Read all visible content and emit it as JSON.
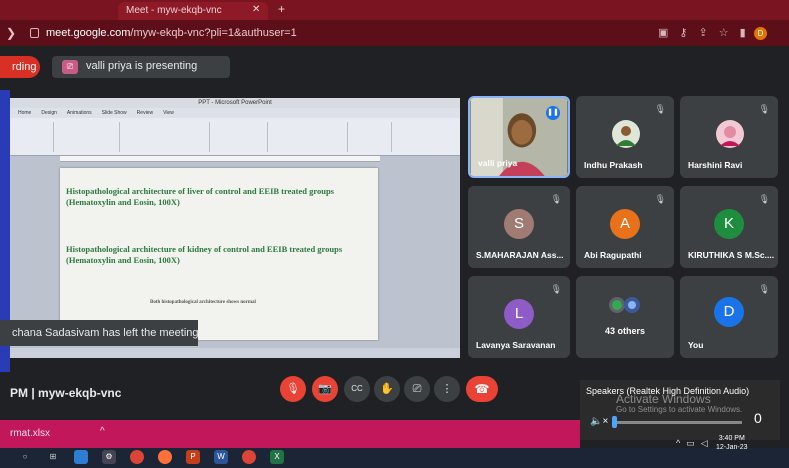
{
  "browser": {
    "tab_title": "Meet - myw-ekqb-vnc",
    "tab_close": "✕",
    "new_tab": "+",
    "url_host": "meet.google.com",
    "url_path": "/myw-ekqb-vnc?pli=1&authuser=1",
    "profile_initial": "D"
  },
  "meet": {
    "recording_label": "rding",
    "presenting_text": "valli priya is presenting",
    "toast": "chana Sadasivam has left the meeting",
    "meeting_info": "PM  |  myw-ekqb-vnc"
  },
  "presentation": {
    "window_title": "PPT - Microsoft PowerPoint",
    "ribbon_tabs": [
      "Home",
      "Design",
      "Animations",
      "Slide Show",
      "Review",
      "View"
    ],
    "slide_line_1": "Histopathological architecture of liver of control and EEIB treated groups (Hematoxylin and Eosin, 100X)",
    "slide_line_2": "Histopathological architecture of kidney of control and EEIB treated groups (Hematoxylin and Eosin, 100X)",
    "slide_note": "Both histopathological architecture shows normal"
  },
  "participants": [
    {
      "name": "valli priya",
      "type": "video",
      "speaking": true,
      "color": "#7a5a3a"
    },
    {
      "name": "Indhu Prakash",
      "type": "photo",
      "color": "#2e7d32"
    },
    {
      "name": "Harshini Ravi",
      "type": "photo",
      "color": "#c2185b"
    },
    {
      "name": "S.MAHARAJAN Ass...",
      "initial": "S",
      "color": "#a07b74"
    },
    {
      "name": "Abi Ragupathi",
      "initial": "A",
      "color": "#e8711a"
    },
    {
      "name": "KIRUTHIKA S M.Sc....",
      "initial": "K",
      "color": "#1e8e3e"
    },
    {
      "name": "Lavanya Saravanan",
      "initial": "L",
      "color": "#8e5bc7"
    },
    {
      "name": "43 others",
      "type": "others"
    },
    {
      "name": "You",
      "initial": "D",
      "color": "#1a73e8"
    }
  ],
  "controls": {
    "mic": "🎙",
    "camera": "📷",
    "captions": "CC",
    "raise_hand": "✋",
    "present": "⎚",
    "more": "⋮",
    "end": "☎"
  },
  "volume": {
    "device": "Speakers (Realtek High Definition Audio)",
    "level": 0,
    "level_label": "0",
    "speaker_glyph": "🔈×"
  },
  "windows_watermark": {
    "line1": "Activate Windows",
    "line2": "Go to Settings to activate Windows."
  },
  "download": {
    "file": "rmat.xlsx",
    "chevron": "^"
  },
  "taskbar": {
    "time": "3:40 PM",
    "date": "12-Jan-23"
  }
}
